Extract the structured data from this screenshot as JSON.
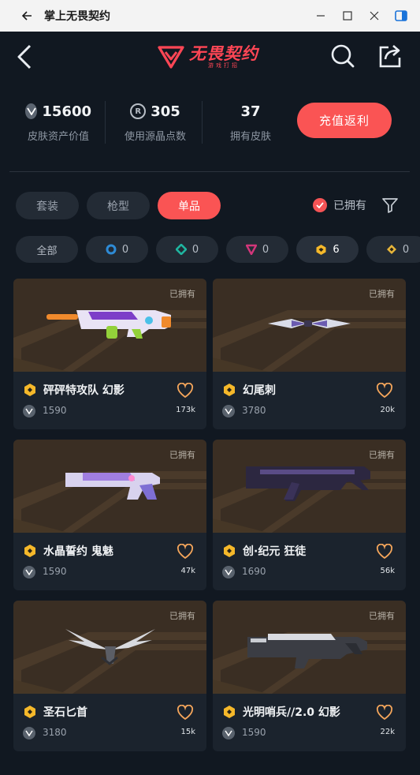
{
  "window": {
    "title": "掌上无畏契约"
  },
  "header": {
    "logo_text": "无畏契约",
    "logo_sub": "游戏打招"
  },
  "stats": {
    "asset_value": "15600",
    "asset_label": "皮肤资产价值",
    "points_used": "305",
    "points_label": "使用源晶点数",
    "skins_owned": "37",
    "skins_label": "拥有皮肤",
    "recharge_label": "充值返利"
  },
  "tabs": [
    {
      "label": "套装",
      "active": false
    },
    {
      "label": "枪型",
      "active": false
    },
    {
      "label": "单品",
      "active": true
    }
  ],
  "owned_filter": {
    "label": "已拥有",
    "checked": true
  },
  "tier_chips": [
    {
      "label": "全部",
      "icon": "all"
    },
    {
      "count": "0",
      "icon": "select-tier-icon",
      "color": "#2e8bd6"
    },
    {
      "count": "0",
      "icon": "deluxe-tier-icon",
      "color": "#1fb5a0"
    },
    {
      "count": "0",
      "icon": "premium-tier-icon",
      "color": "#d2367a"
    },
    {
      "count": "6",
      "icon": "exclusive-tier-icon",
      "color": "#f5b82a",
      "active": true
    },
    {
      "count": "0",
      "icon": "ultra-tier-icon",
      "color": "#e8b63a"
    }
  ],
  "items": [
    {
      "name": "砰砰特攻队 幻影",
      "price": "1590",
      "likes": "173k",
      "owned": "已拥有",
      "weapon": "rifle-bubble"
    },
    {
      "name": "幻尾刺",
      "price": "3780",
      "likes": "20k",
      "owned": "已拥有",
      "weapon": "knife"
    },
    {
      "name": "水晶誓约 鬼魅",
      "price": "1590",
      "likes": "47k",
      "owned": "已拥有",
      "weapon": "pistol"
    },
    {
      "name": "创·纪元 狂徒",
      "price": "1690",
      "likes": "56k",
      "owned": "已拥有",
      "weapon": "rifle-dark"
    },
    {
      "name": "圣石匕首",
      "price": "3180",
      "likes": "15k",
      "owned": "已拥有",
      "weapon": "wing-knife"
    },
    {
      "name": "光明哨兵//2.0 幻影",
      "price": "1590",
      "likes": "22k",
      "owned": "已拥有",
      "weapon": "rifle-silver"
    }
  ],
  "colors": {
    "accent": "#fa5454",
    "background": "#111821",
    "card": "#1b232d",
    "tier_gold": "#f5b82a"
  }
}
